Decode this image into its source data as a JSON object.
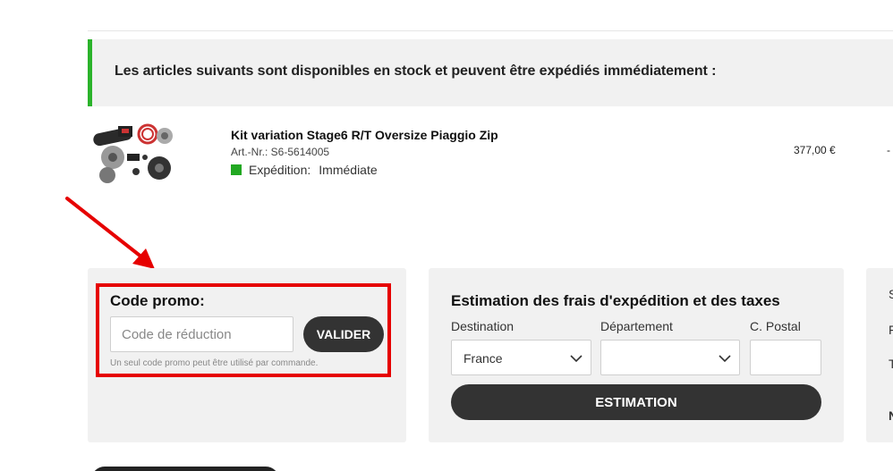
{
  "stock_banner": {
    "text": "Les articles suivants sont disponibles en stock et peuvent être expédiés immédiatement :",
    "accent_color": "#2bb32b"
  },
  "product": {
    "name": "Kit variation Stage6 R/T Oversize Piaggio Zip",
    "sku": "Art.-Nr.: S6-5614005",
    "shipping_label": "Expédition:",
    "shipping_value": "Immédiate",
    "price": "377,00 €",
    "trailing": "-",
    "image_icon": "variator-kit-image"
  },
  "promo": {
    "title": "Code promo:",
    "input_placeholder": "Code de réduction",
    "input_value": "",
    "button_label": "VALIDER",
    "note": "Un seul code promo peut être utilisé par commande.",
    "highlight_color": "#e60000"
  },
  "shipping_estimate": {
    "title": "Estimation des frais d'expédition et des taxes",
    "destination_label": "Destination",
    "destination_value": "France",
    "department_label": "Département",
    "department_value": "",
    "postal_label": "C. Postal",
    "postal_value": "",
    "button_label": "ESTIMATION"
  },
  "summary_panel": {
    "row_letters": [
      "S",
      "F",
      "T",
      "N"
    ]
  },
  "annotation": {
    "arrow_color": "#e60000"
  }
}
